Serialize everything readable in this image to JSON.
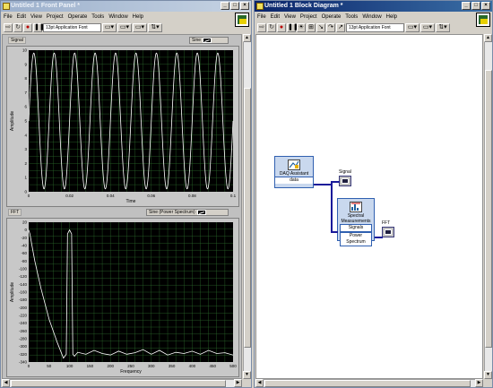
{
  "front_panel": {
    "title": "Untitled 1 Front Panel *",
    "menu": [
      "File",
      "Edit",
      "View",
      "Project",
      "Operate",
      "Tools",
      "Window",
      "Help"
    ],
    "font_select": "13pt Application Font",
    "signal_graph": {
      "label": "Signal",
      "legend": "Sine",
      "ylabel": "Amplitude",
      "xlabel": "Time",
      "yticks": [
        "10",
        "9",
        "8",
        "7",
        "6",
        "5",
        "4",
        "3",
        "2",
        "1",
        "0"
      ],
      "xticks": [
        "0",
        "0.02",
        "0.04",
        "0.06",
        "0.08",
        "0.1"
      ]
    },
    "fft_graph": {
      "label": "FFT",
      "legend": "Sine (Power Spectrum)",
      "ylabel": "Amplitude",
      "xlabel": "Frequency",
      "yticks": [
        "20",
        "0",
        "-20",
        "-40",
        "-60",
        "-80",
        "-100",
        "-120",
        "-140",
        "-160",
        "-180",
        "-200",
        "-220",
        "-240",
        "-260",
        "-280",
        "-300",
        "-320",
        "-340"
      ],
      "xticks": [
        "0",
        "50",
        "100",
        "150",
        "200",
        "250",
        "300",
        "350",
        "400",
        "450",
        "500"
      ]
    }
  },
  "block_diagram": {
    "title": "Untitled 1 Block Diagram *",
    "menu": [
      "File",
      "Edit",
      "View",
      "Project",
      "Operate",
      "Tools",
      "Window",
      "Help"
    ],
    "font_select": "13pt Application Font",
    "daq_node": {
      "title": "DAQ Assistant",
      "terminal": "data"
    },
    "spectral_node": {
      "title_line1": "Spectral",
      "title_line2": "Measurements",
      "terminal1": "Signals",
      "terminal2": "Power Spectrum"
    },
    "signal_terminal_label": "Signal",
    "fft_terminal_label": "FFT"
  },
  "colors": {
    "plot_bg": "#000000",
    "grid": "#2c6b2c",
    "trace": "#ffffff",
    "wire": "#1a1a9a",
    "node": "#c9d8ee"
  },
  "chart_data": [
    {
      "type": "line",
      "series": [
        {
          "name": "Sine",
          "description": "sine wave, ~100 Hz, amplitude 0 to 10"
        }
      ],
      "xlabel": "Time",
      "ylabel": "Amplitude",
      "xlim": [
        0,
        0.1
      ],
      "ylim": [
        0,
        10
      ],
      "frequency_hz": 100,
      "cycles": 10,
      "grid": true
    },
    {
      "type": "line",
      "series": [
        {
          "name": "Sine (Power Spectrum)"
        }
      ],
      "xlabel": "Frequency",
      "ylabel": "Amplitude",
      "xlim": [
        0,
        500
      ],
      "ylim": [
        -340,
        20
      ],
      "x": [
        0,
        3,
        8,
        15,
        30,
        50,
        70,
        85,
        92,
        95,
        100,
        105,
        108,
        112,
        120,
        140,
        160,
        180,
        200,
        220,
        240,
        260,
        280,
        300,
        320,
        340,
        360,
        380,
        400,
        420,
        440,
        460,
        480,
        500
      ],
      "y": [
        0,
        -10,
        -40,
        -80,
        -150,
        -230,
        -290,
        -330,
        -320,
        -10,
        0,
        -10,
        -320,
        -325,
        -315,
        -320,
        -310,
        -318,
        -322,
        -312,
        -320,
        -316,
        -308,
        -320,
        -310,
        -322,
        -315,
        -318,
        -312,
        -320,
        -310,
        -318,
        -316,
        -322
      ],
      "grid": true
    }
  ]
}
